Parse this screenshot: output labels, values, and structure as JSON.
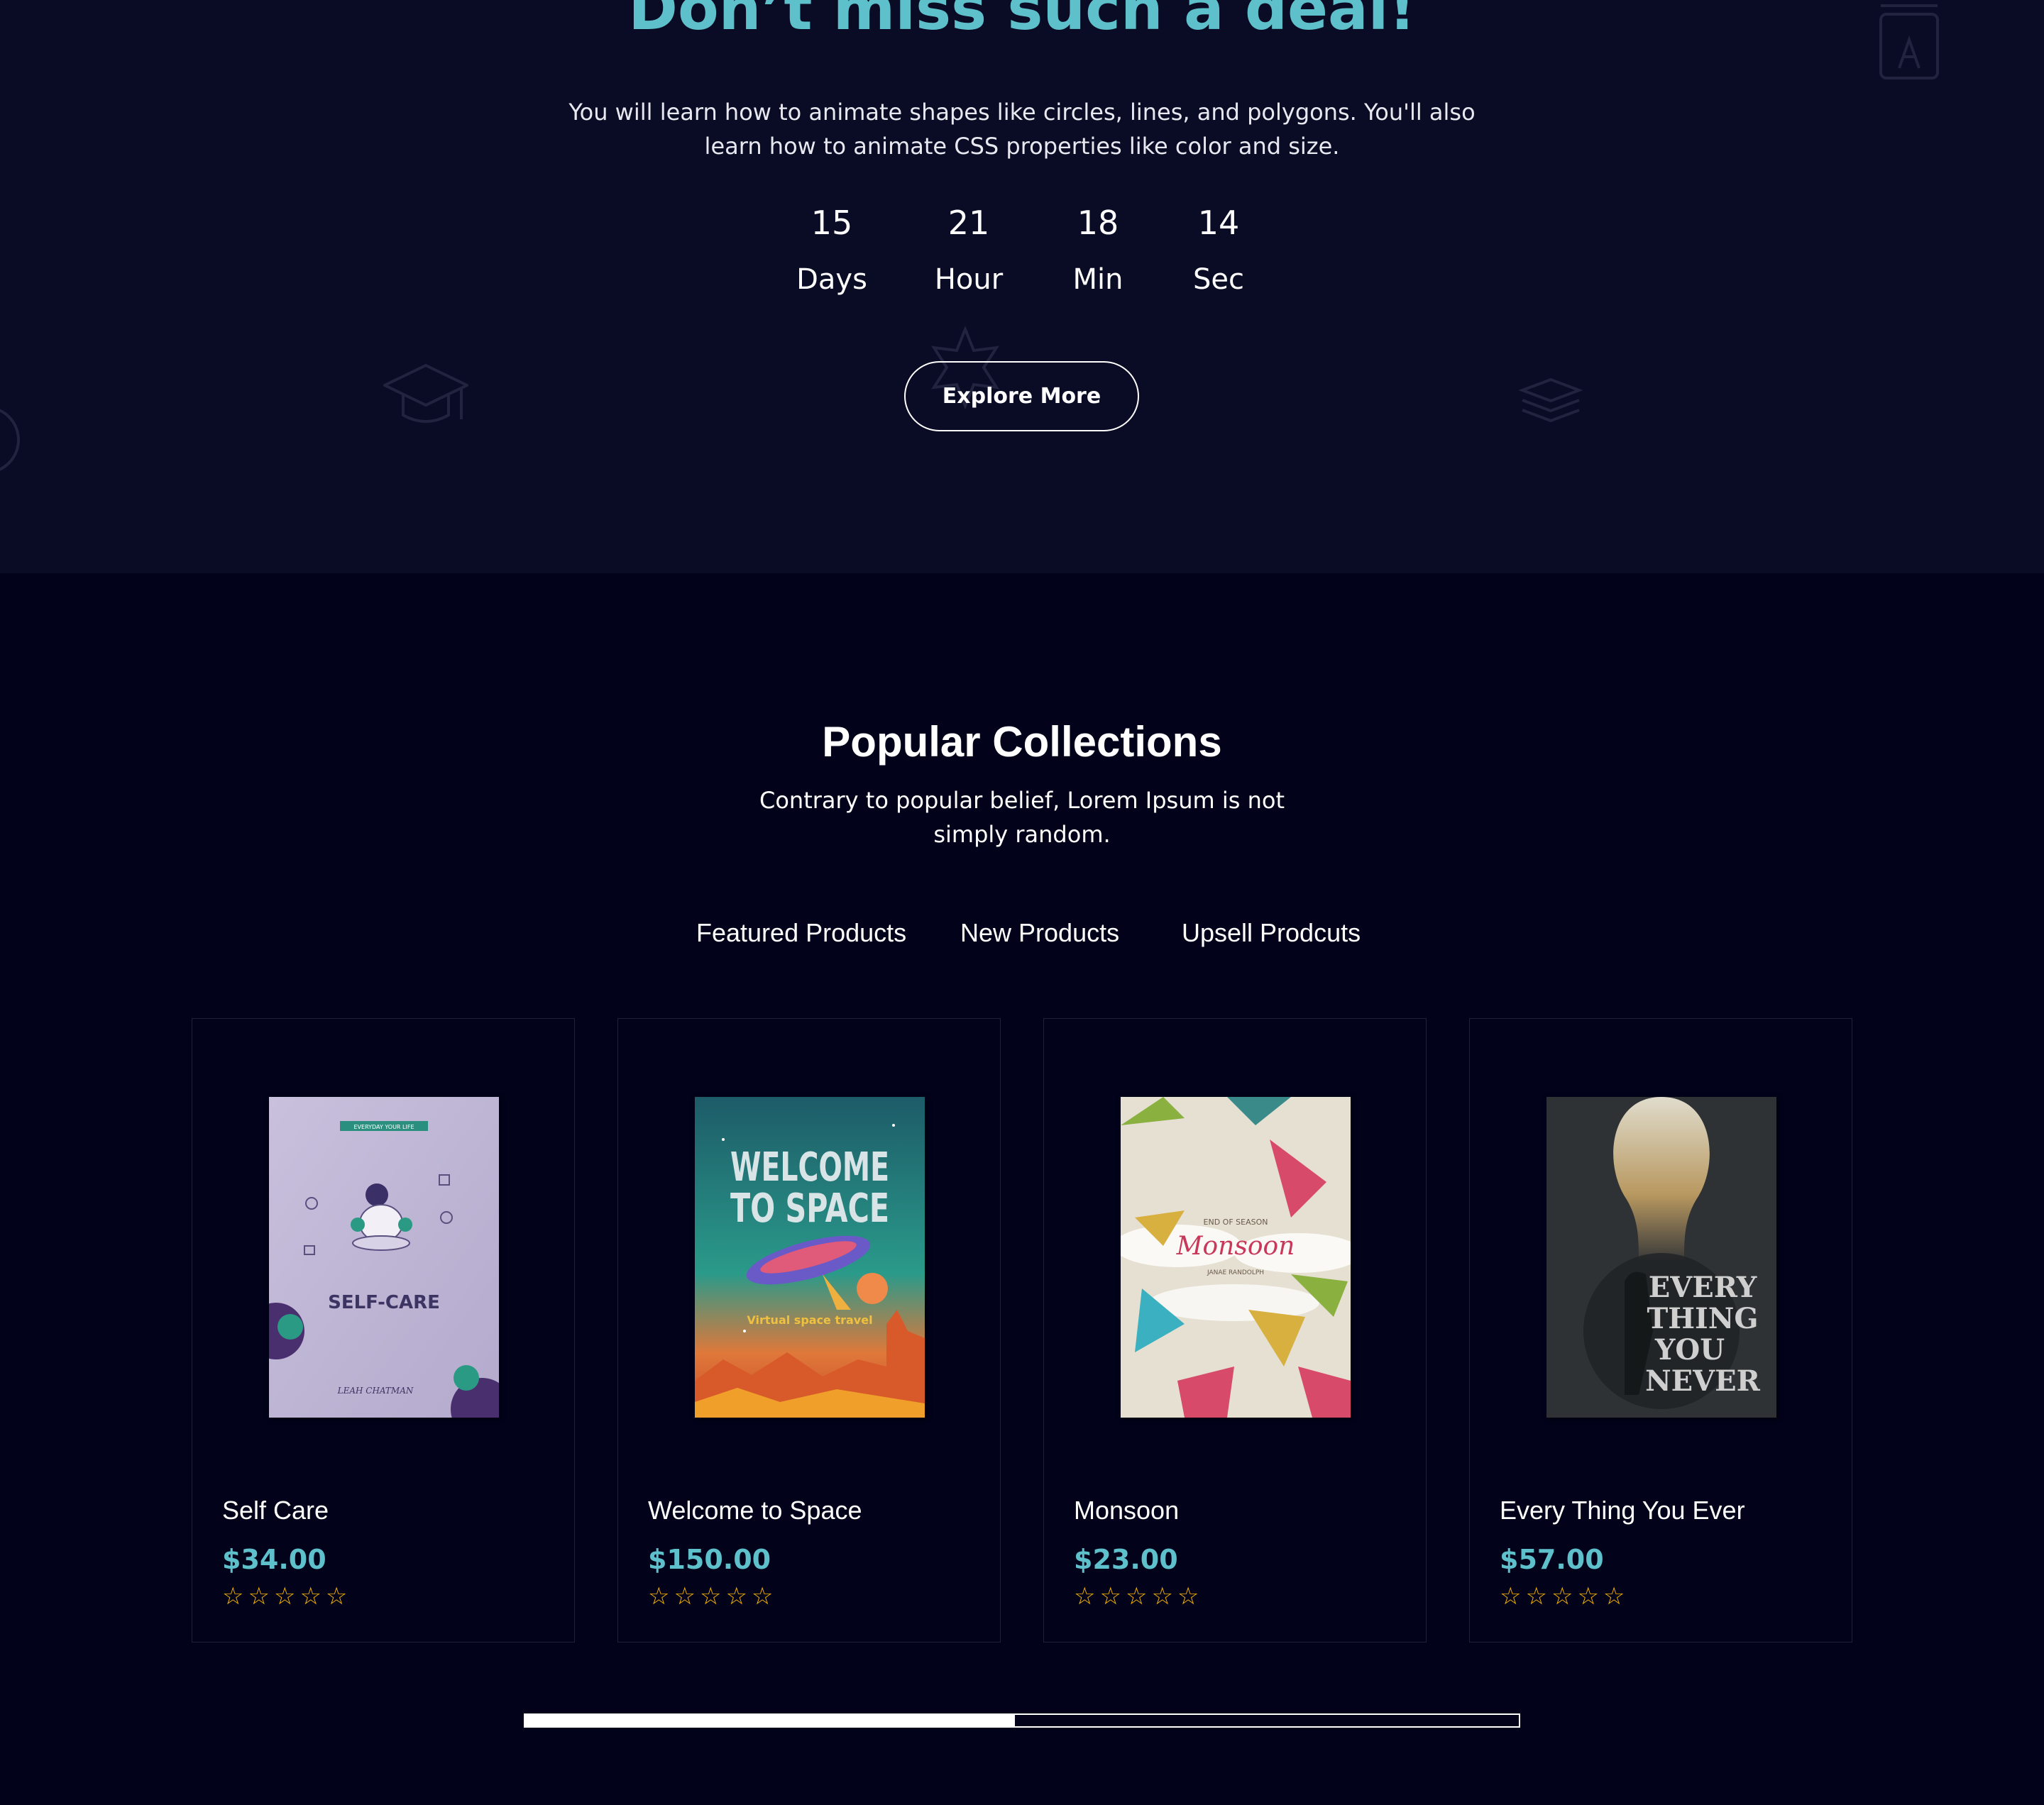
{
  "deal": {
    "title": "Don’t miss such a deal!",
    "description": "You will learn how to animate shapes like circles, lines, and polygons. You'll also learn how to animate CSS properties like color and size.",
    "countdown": [
      {
        "value": "15",
        "label": "Days"
      },
      {
        "value": "21",
        "label": "Hour"
      },
      {
        "value": "18",
        "label": "Min"
      },
      {
        "value": "14",
        "label": "Sec"
      }
    ],
    "button_label": "Explore More",
    "accent_color": "#5ec0cb"
  },
  "popular": {
    "title": "Popular Collections",
    "description": "Contrary to popular belief, Lorem Ipsum is not simply random.",
    "tabs": [
      "Featured Products",
      "New Products",
      "Upsell Prodcuts"
    ]
  },
  "products": [
    {
      "name": "Self Care",
      "price": "$34.00",
      "rating": "☆☆☆☆☆",
      "cover": {
        "top": "EVERYDAY YOUR LIFE",
        "title": "SELF-CARE",
        "author": "LEAH CHATMAN"
      }
    },
    {
      "name": "Welcome to Space",
      "price": "$150.00",
      "rating": "☆☆☆☆☆",
      "cover": {
        "title1": "WELCOME",
        "title2": "TO SPACE",
        "subtitle": "Virtual space travel"
      }
    },
    {
      "name": "Monsoon",
      "price": "$23.00",
      "rating": "☆☆☆☆☆",
      "cover": {
        "top": "END OF SEASON",
        "title": "Monsoon",
        "author": "JANAE RANDOLPH"
      }
    },
    {
      "name": "Every Thing You Ever",
      "price": "$57.00",
      "rating": "☆☆☆☆☆",
      "cover": {
        "line1": "EVERY",
        "line2": "THING",
        "line3": "YOU",
        "line4": "NEVER"
      }
    }
  ],
  "carousel_progress": 0.493,
  "colors": {
    "background": "#02021a",
    "deal_background": "#0a0b24",
    "price": "#5ec0cb",
    "stars": "#f5b400"
  }
}
